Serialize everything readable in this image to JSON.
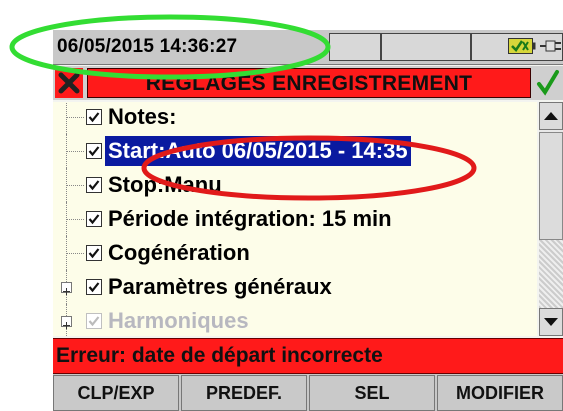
{
  "status": {
    "datetime": "06/05/2015 14:36:27"
  },
  "title": "REGLAGES ENREGISTREMENT",
  "icons": {
    "cancel": "cancel-x-icon",
    "confirm": "checkmark-icon",
    "battery": "battery-icon",
    "plug": "power-plug-icon"
  },
  "rows": [
    {
      "label": "Notes:",
      "checked": true
    },
    {
      "label": "Start:Auto 06/05/2015 - 14:35",
      "checked": true,
      "selected": true
    },
    {
      "label": "Stop:Manu",
      "checked": true
    },
    {
      "label": "Période intégration: 15 min",
      "checked": true
    },
    {
      "label": "Cogénération",
      "checked": true
    },
    {
      "label": "Paramètres généraux",
      "checked": true,
      "expandable": true
    },
    {
      "label": "Harmoniques",
      "checked": true,
      "expandable": true
    }
  ],
  "error": "Erreur: date de départ incorrecte",
  "fkeys": [
    "CLP/EXP",
    "PREDEF.",
    "SEL",
    "MODIFIER"
  ],
  "colors": {
    "error_red": "#ff1a1a",
    "selection_blue": "#0a1aa0",
    "annotation_green": "#33dd33",
    "annotation_red": "#e11a1a"
  }
}
